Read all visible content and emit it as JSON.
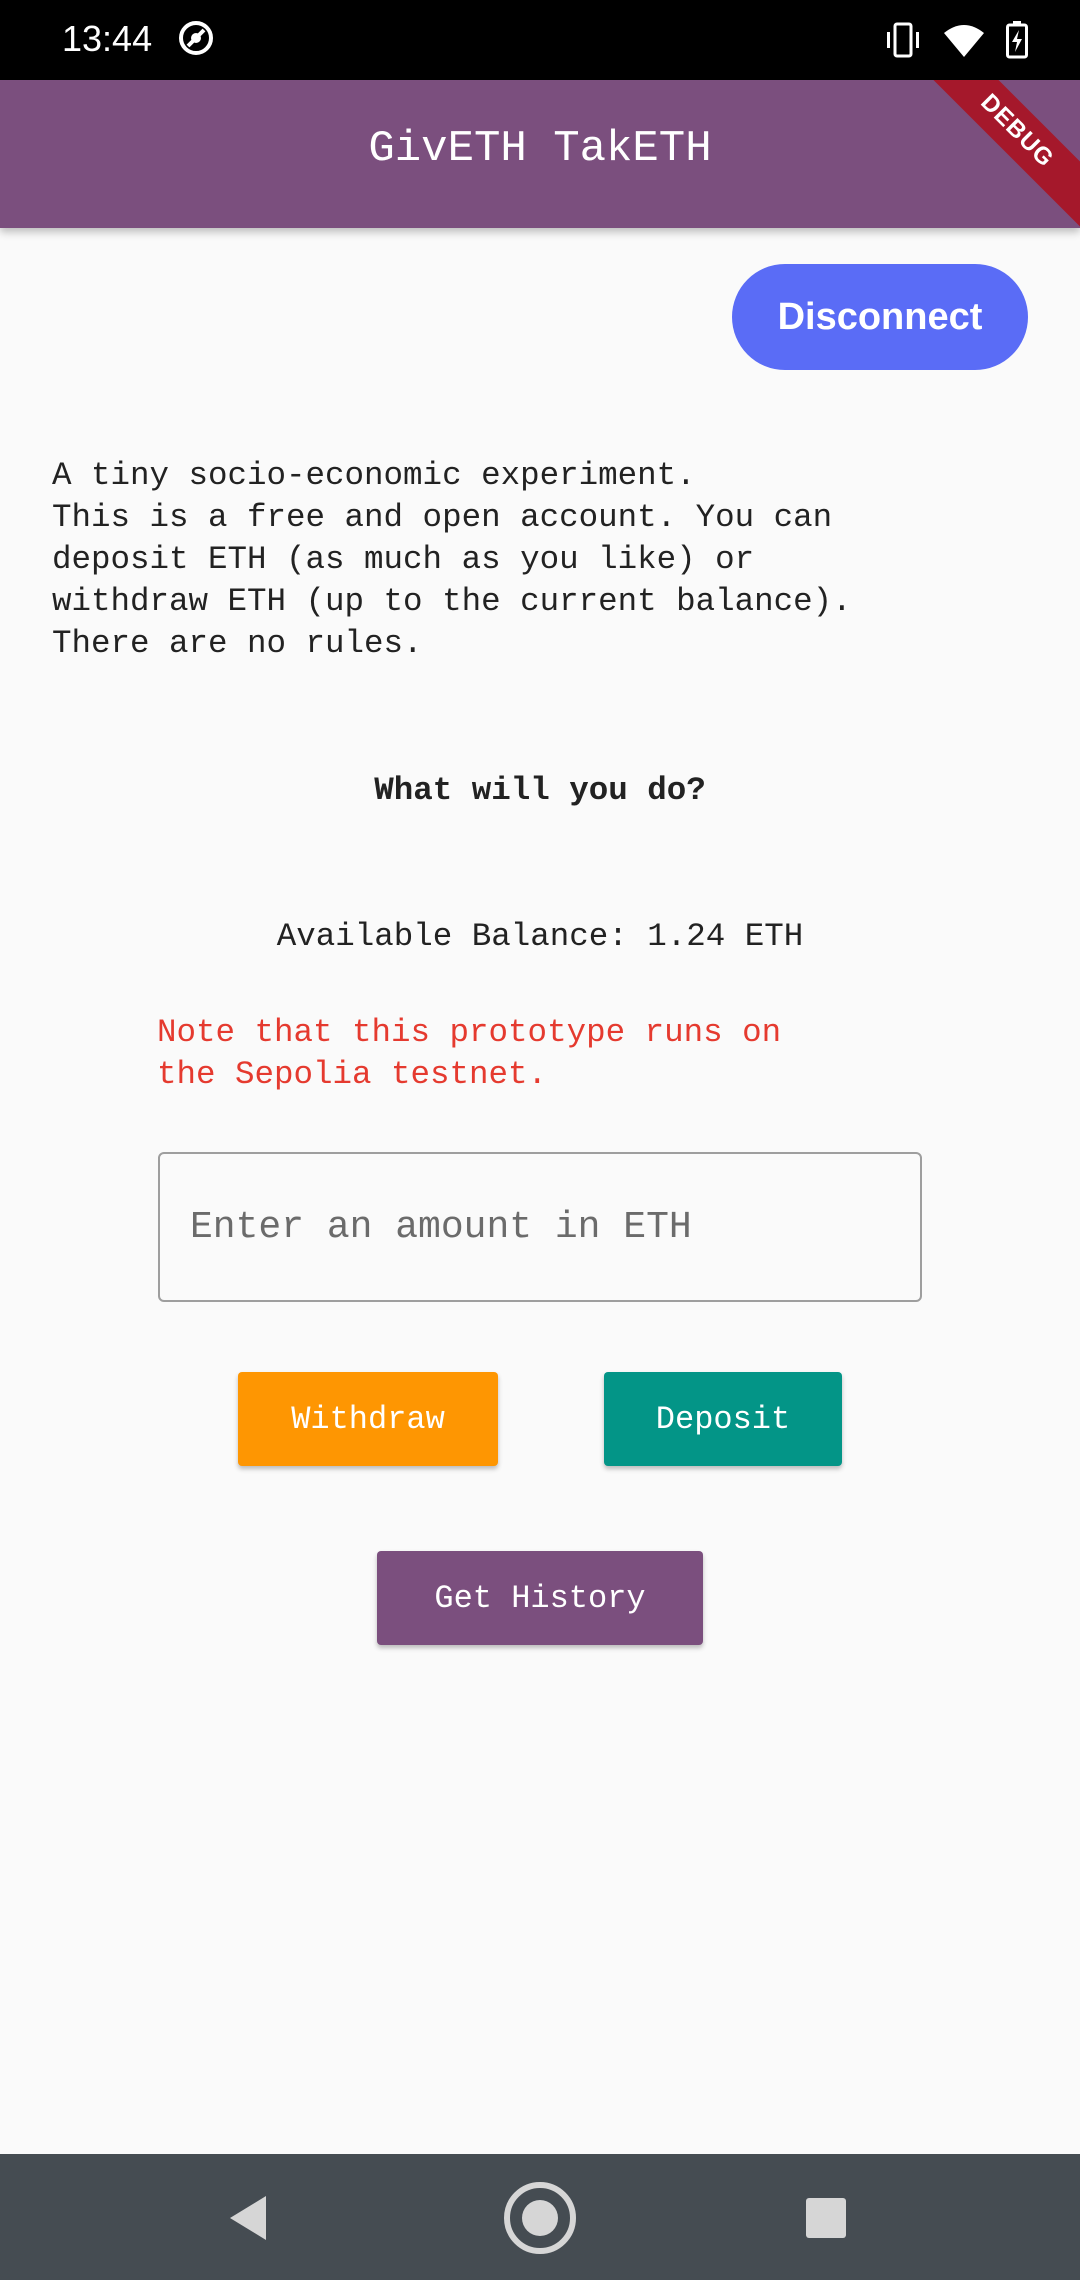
{
  "status_bar": {
    "time": "13:44",
    "icons": [
      "app-notification-icon",
      "vibrate-icon",
      "wifi-icon",
      "battery-charging-icon"
    ]
  },
  "app_bar": {
    "title": "GivETH TakETH",
    "debug_banner": "DEBUG",
    "color": "#7b4f7e"
  },
  "wallet": {
    "disconnect_label": "Disconnect"
  },
  "content": {
    "intro": "A tiny socio-economic experiment.\nThis is a free and open account. You can\ndeposit ETH (as much as you like) or\nwithdraw ETH (up to the current balance).\nThere are no rules.",
    "question": "What will you do?",
    "balance": "Available Balance: 1.24 ETH",
    "note": "Note that this prototype runs on\nthe Sepolia testnet."
  },
  "amount_input": {
    "value": "",
    "placeholder": "Enter an amount in ETH"
  },
  "actions": {
    "withdraw_label": "Withdraw",
    "deposit_label": "Deposit",
    "history_label": "Get History"
  },
  "colors": {
    "withdraw": "#fe9602",
    "deposit": "#039587",
    "disconnect": "#5a6cf6",
    "note": "#e53a2f"
  },
  "nav_bar": {
    "icons": [
      "back-icon",
      "home-icon",
      "recents-icon"
    ]
  }
}
